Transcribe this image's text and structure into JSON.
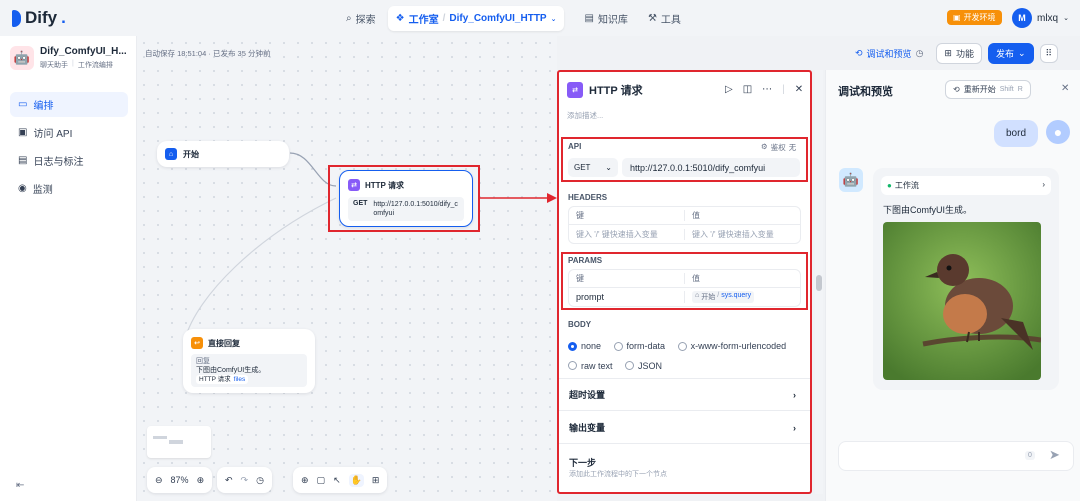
{
  "topbar": {
    "logo": "Dify",
    "nav": [
      {
        "label": "探索",
        "icon": "explore-icon"
      },
      {
        "label": "工作室",
        "icon": "studio-icon"
      },
      {
        "label": "Dify_ComfyUI_HTTP",
        "icon": "chevron-down-icon"
      },
      {
        "label": "知识库",
        "icon": "knowledge-icon"
      },
      {
        "label": "工具",
        "icon": "tools-icon"
      }
    ],
    "env_badge": "开发环境",
    "user_initial": "M",
    "user_name": "mlxq"
  },
  "sidebar": {
    "app_name": "Dify_ComfyUI_H...",
    "app_tags": [
      "聊天助手",
      "工作流编排"
    ],
    "items": [
      {
        "label": "编排",
        "icon": "layout-icon"
      },
      {
        "label": "访问 API",
        "icon": "terminal-icon"
      },
      {
        "label": "日志与标注",
        "icon": "log-icon"
      },
      {
        "label": "监测",
        "icon": "monitor-icon"
      }
    ]
  },
  "canvas": {
    "autosave": "自动保存 18:51:04 · 已发布 35 分钟前",
    "start_node": "开始",
    "http_node": {
      "title": "HTTP 请求",
      "method": "GET",
      "url": "http://127.0.0.1:5010/dify_comfyui"
    },
    "answer_node": {
      "title": "直接回复",
      "label": "回复",
      "text": "下图由ComfyUI生成。",
      "ref_node": "HTTP 请求",
      "ref_var": "files"
    },
    "zoom": "87%"
  },
  "toolbar": {
    "debug_label": "调试和预览",
    "features_label": "功能",
    "publish_label": "发布"
  },
  "panel": {
    "title": "HTTP 请求",
    "desc_placeholder": "添加描述...",
    "api_label": "API",
    "auth_label": "鉴权",
    "auth_value": "无",
    "method": "GET",
    "url": "http://127.0.0.1:5010/dify_comfyui",
    "headers_label": "HEADERS",
    "key_header": "键",
    "value_header": "值",
    "headers_key_placeholder": "键入 '/' 键快速插入变量",
    "headers_val_placeholder": "键入 '/' 键快速插入变量",
    "params_label": "PARAMS",
    "param_key": "prompt",
    "param_src": "开始",
    "param_var": "sys.query",
    "body_label": "BODY",
    "body_options": [
      "none",
      "form-data",
      "x-www-form-urlencoded",
      "raw text",
      "JSON"
    ],
    "timeout_label": "超时设置",
    "output_label": "输出变量",
    "next_label": "下一步",
    "next_desc": "添加此工作流程中的下一个节点"
  },
  "debug": {
    "title": "调试和预览",
    "restart_label": "重新开始",
    "shortcut_1": "Shift",
    "shortcut_2": "R",
    "user_msg": "bord",
    "workflow_label": "工作流",
    "answer_text": "下图由ComfyUI生成。",
    "input_counter": "0"
  },
  "colors": {
    "primary": "#155eef",
    "highlight": "#e0262e",
    "env": "#f79009"
  }
}
